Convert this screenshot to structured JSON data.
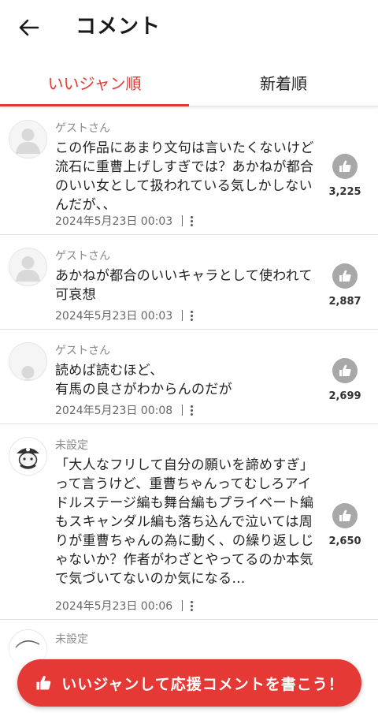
{
  "header": {
    "title": "コメント",
    "back_icon": "arrow-left-icon"
  },
  "tabs": [
    {
      "label": "いいジャン順",
      "active": true
    },
    {
      "label": "新着順",
      "active": false
    }
  ],
  "colors": {
    "accent": "#e53935",
    "like_circle": "#a8a8a8"
  },
  "comments": [
    {
      "author": "ゲストさん",
      "avatar": "default-user-icon",
      "text": "この作品にあまり文句は言いたくないけど流石に重曹上げしすぎでは？あかねが都合のいい女として扱われている気しかしないんだが、、",
      "date": "2024年5月23日 00:03",
      "likes": "3,225"
    },
    {
      "author": "ゲストさん",
      "avatar": "default-user-icon",
      "text": "あかねが都合のいいキャラとして使われて可哀想",
      "date": "2024年5月23日 00:03",
      "likes": "2,887"
    },
    {
      "author": "ゲストさん",
      "avatar": "default-user-icon",
      "text": "読めば読むほど、\n有馬の良さがわからんのだが",
      "date": "2024年5月23日 00:08",
      "likes": "2,699"
    },
    {
      "author": "未設定",
      "avatar": "pirate-character-icon",
      "text": "「大人なフリして自分の願いを諦めすぎ」って言うけど、重曹ちゃんってむしろアイドルステージ編も舞台編もプライベート編もスキャンダル編も落ち込んで泣いては周りが重曹ちゃんの為に動く、の繰り返しじゃないか？作者がわざとやってるのか本気で気づいてないのか気になる…",
      "date": "2024年5月23日 00:06",
      "likes": "2,650"
    },
    {
      "author": "未設定",
      "avatar": "character-icon",
      "text": "",
      "date": "",
      "likes": ""
    }
  ],
  "cta": {
    "label": "いいジャンして応援コメントを書こう！",
    "icon": "thumbs-up-icon"
  }
}
